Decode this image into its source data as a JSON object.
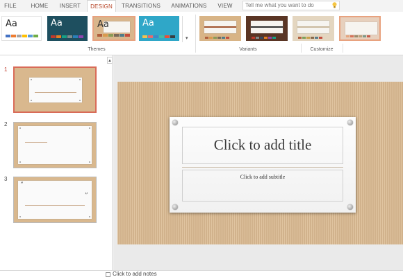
{
  "ribbon": {
    "tabs": [
      {
        "label": "FILE"
      },
      {
        "label": "HOME"
      },
      {
        "label": "INSERT"
      },
      {
        "label": "DESIGN"
      },
      {
        "label": "TRANSITIONS"
      },
      {
        "label": "ANIMATIONS"
      },
      {
        "label": "VIEW"
      }
    ],
    "active_tab": "DESIGN",
    "tell_me_placeholder": "Tell me what you want to do",
    "themes": [
      {
        "sample": "Aa",
        "bg": "#ffffff",
        "fg": "#222222",
        "palette": [
          "#4472c4",
          "#ed7d31",
          "#a5a5a5",
          "#ffc000",
          "#5b9bd5",
          "#70ad47"
        ]
      },
      {
        "sample": "Aa",
        "bg": "#1e4f5f",
        "fg": "#ffffff",
        "palette": [
          "#c0392b",
          "#e67e22",
          "#16a085",
          "#7f8c8d",
          "#2980b9",
          "#8e44ad"
        ]
      },
      {
        "sample": "Aa",
        "bg": "#d9b68c",
        "fg": "#333333",
        "palette": [
          "#b05f3c",
          "#d99a4e",
          "#8a9b57",
          "#7a6a5a",
          "#4f7c8a",
          "#c44d3d"
        ]
      },
      {
        "sample": "Aa",
        "bg": "#2fa7c8",
        "fg": "#ffffff",
        "palette": [
          "#f2c14e",
          "#e56b6f",
          "#3f88c5",
          "#44bba4",
          "#e94f37",
          "#393e41"
        ]
      }
    ],
    "themes_label": "Themes",
    "variants": [
      {
        "bg": "#d8b486",
        "bar": "#a0522d",
        "palette": [
          "#b05f3c",
          "#d99a4e",
          "#8a9b57",
          "#7a6a5a",
          "#4f7c8a",
          "#c44d3d"
        ]
      },
      {
        "bg": "#5a3524",
        "bar": "#2f2f2f",
        "palette": [
          "#c0392b",
          "#7f8c8d",
          "#34495e",
          "#e67e22",
          "#8e44ad",
          "#16a085"
        ]
      },
      {
        "bg": "#e4d6c0",
        "bar": "#c9b89c",
        "palette": [
          "#b05f3c",
          "#7fa05a",
          "#c9a14a",
          "#8a6a4a",
          "#5a7c8a",
          "#c44d3d"
        ]
      },
      {
        "bg": "#e7d0bd",
        "bar": "#e7d0bd",
        "palette": [
          "#e6a57e",
          "#d6735a",
          "#9b8a6a",
          "#bba07a",
          "#7c9a8a",
          "#c45d4d"
        ]
      }
    ],
    "variants_label": "Variants",
    "customize_label": "Customize"
  },
  "slides": [
    {
      "number": "1"
    },
    {
      "number": "2"
    },
    {
      "number": "3",
      "open_quote": "“",
      "close_quote": "”"
    }
  ],
  "main_slide": {
    "title_placeholder": "Click to add title",
    "subtitle_placeholder": "Click to add subtitle"
  },
  "notes_placeholder": "Click to add notes",
  "colors": {
    "accent": "#b7472a",
    "kraft": "#dcbc93"
  }
}
